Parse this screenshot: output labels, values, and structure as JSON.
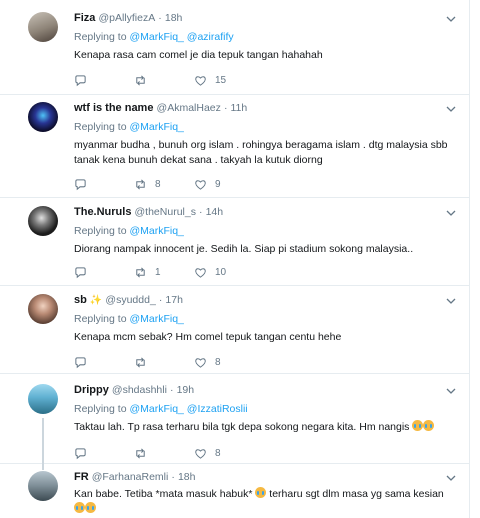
{
  "tweets": [
    {
      "name": "Fiza",
      "handle": "@pAllyfiezA",
      "time": "18h",
      "replying_prefix": "Replying to",
      "mentions": "@MarkFiq_ @azirafify",
      "text": "Kenapa rasa cam comel je dia tepuk tangan hahahah",
      "reply_count": "",
      "retweet_count": "",
      "like_count": "15"
    },
    {
      "name": "wtf is the name",
      "handle": "@AkmalHaez",
      "time": "11h",
      "replying_prefix": "Replying to",
      "mentions": "@MarkFiq_",
      "text": "myanmar budha , bunuh org islam . rohingya beragama islam . dtg malaysia sbb tanak kena bunuh dekat sana . takyah la kutuk diorng",
      "reply_count": "",
      "retweet_count": "8",
      "like_count": "9"
    },
    {
      "name": "The.Nuruls",
      "handle": "@theNurul_s",
      "time": "14h",
      "replying_prefix": "Replying to",
      "mentions": "@MarkFiq_",
      "text": "Diorang nampak innocent je. Sedih la. Siap pi stadium sokong malaysia..",
      "reply_count": "",
      "retweet_count": "1",
      "like_count": "10"
    },
    {
      "name": "sb",
      "handle": "@syuddd_",
      "time": "17h",
      "replying_prefix": "Replying to",
      "mentions": "@MarkFiq_",
      "text": "Kenapa mcm sebak? Hm comel tepuk tangan centu hehe",
      "reply_count": "",
      "retweet_count": "",
      "like_count": "8"
    },
    {
      "name": "Drippy",
      "handle": "@shdashhli",
      "time": "19h",
      "replying_prefix": "Replying to",
      "mentions": "@MarkFiq_ @IzzatiRoslii",
      "text": "Taktau lah. Tp rasa terharu bila tgk depa sokong negara kita. Hm nangis",
      "reply_count": "",
      "retweet_count": "",
      "like_count": "8"
    },
    {
      "name": "FR",
      "handle": "@FarhanaRemli",
      "time": "18h",
      "text_part1": "Kan babe. Tetiba *mata masuk habuk*",
      "text_part2": "terharu sgt dlm masa yg sama kesian"
    }
  ],
  "separator": "·",
  "icons": [
    "reply-icon",
    "retweet-icon",
    "like-icon",
    "caret-down-icon"
  ],
  "colors": {
    "link": "#1da1f2",
    "muted": "#657786",
    "border": "#e6ecf0"
  }
}
